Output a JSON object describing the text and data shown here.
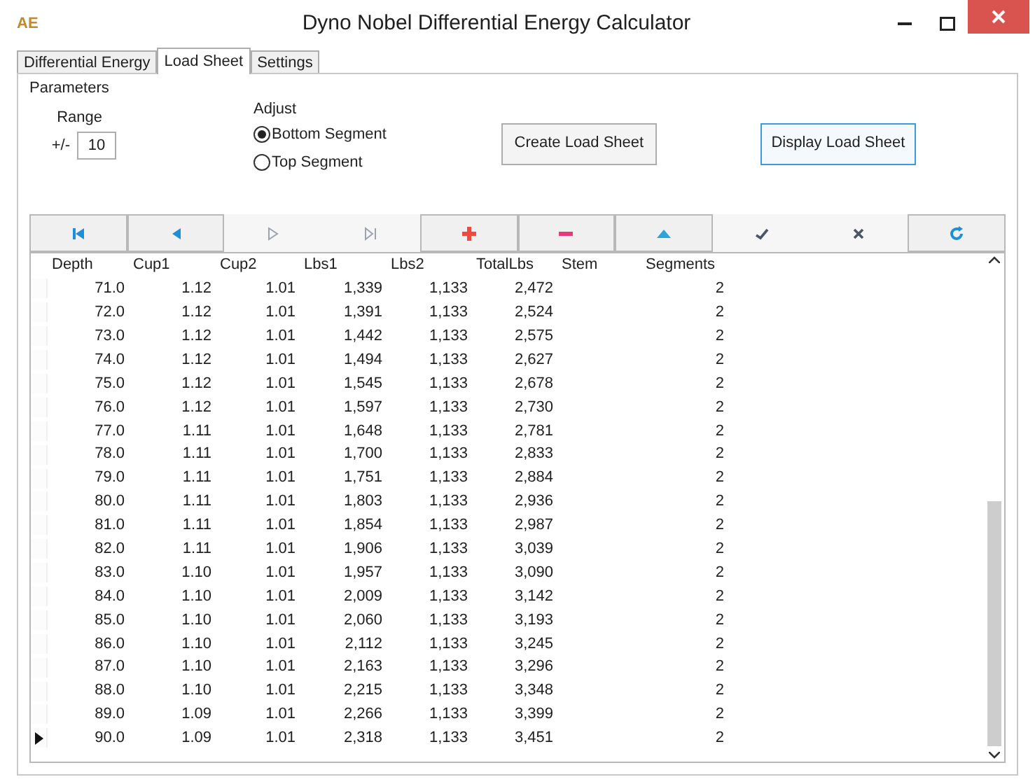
{
  "window": {
    "logo": "AE",
    "title": "Dyno Nobel Differential Energy Calculator"
  },
  "tabs": [
    {
      "label": "Differential Energy",
      "selected": false
    },
    {
      "label": "Load Sheet",
      "selected": true
    },
    {
      "label": "Settings",
      "selected": false
    }
  ],
  "parameters": {
    "title": "Parameters",
    "range_label": "Range",
    "range_prefix": "+/-",
    "range_value": "10",
    "adjust_label": "Adjust",
    "adjust_options": [
      {
        "label": "Bottom Segment",
        "selected": true
      },
      {
        "label": "Top Segment",
        "selected": false
      }
    ],
    "buttons": [
      {
        "label": "Create Load Sheet",
        "focused": false
      },
      {
        "label": "Display Load Sheet",
        "focused": true
      }
    ]
  },
  "toolbar": [
    {
      "kind": "first",
      "disabled": false
    },
    {
      "kind": "prev",
      "disabled": false
    },
    {
      "kind": "next",
      "disabled": true
    },
    {
      "kind": "last",
      "disabled": true
    },
    {
      "kind": "add",
      "disabled": false
    },
    {
      "kind": "delete",
      "disabled": false
    },
    {
      "kind": "edit",
      "disabled": false
    },
    {
      "kind": "post",
      "disabled": true
    },
    {
      "kind": "cancel",
      "disabled": true
    },
    {
      "kind": "refresh",
      "disabled": false
    }
  ],
  "table": {
    "columns": [
      "Depth",
      "Cup1",
      "Cup2",
      "Lbs1",
      "Lbs2",
      "TotalLbs",
      "Stem",
      "Segments"
    ],
    "rows": [
      {
        "cells": [
          "71.0",
          "1.12",
          "1.01",
          "1,339",
          "1,133",
          "2,472",
          "",
          "2"
        ],
        "selected": false
      },
      {
        "cells": [
          "72.0",
          "1.12",
          "1.01",
          "1,391",
          "1,133",
          "2,524",
          "",
          "2"
        ],
        "selected": false
      },
      {
        "cells": [
          "73.0",
          "1.12",
          "1.01",
          "1,442",
          "1,133",
          "2,575",
          "",
          "2"
        ],
        "selected": false
      },
      {
        "cells": [
          "74.0",
          "1.12",
          "1.01",
          "1,494",
          "1,133",
          "2,627",
          "",
          "2"
        ],
        "selected": false
      },
      {
        "cells": [
          "75.0",
          "1.12",
          "1.01",
          "1,545",
          "1,133",
          "2,678",
          "",
          "2"
        ],
        "selected": false
      },
      {
        "cells": [
          "76.0",
          "1.12",
          "1.01",
          "1,597",
          "1,133",
          "2,730",
          "",
          "2"
        ],
        "selected": false
      },
      {
        "cells": [
          "77.0",
          "1.11",
          "1.01",
          "1,648",
          "1,133",
          "2,781",
          "",
          "2"
        ],
        "selected": false
      },
      {
        "cells": [
          "78.0",
          "1.11",
          "1.01",
          "1,700",
          "1,133",
          "2,833",
          "",
          "2"
        ],
        "selected": false
      },
      {
        "cells": [
          "79.0",
          "1.11",
          "1.01",
          "1,751",
          "1,133",
          "2,884",
          "",
          "2"
        ],
        "selected": false
      },
      {
        "cells": [
          "80.0",
          "1.11",
          "1.01",
          "1,803",
          "1,133",
          "2,936",
          "",
          "2"
        ],
        "selected": false
      },
      {
        "cells": [
          "81.0",
          "1.11",
          "1.01",
          "1,854",
          "1,133",
          "2,987",
          "",
          "2"
        ],
        "selected": false
      },
      {
        "cells": [
          "82.0",
          "1.11",
          "1.01",
          "1,906",
          "1,133",
          "3,039",
          "",
          "2"
        ],
        "selected": false
      },
      {
        "cells": [
          "83.0",
          "1.10",
          "1.01",
          "1,957",
          "1,133",
          "3,090",
          "",
          "2"
        ],
        "selected": false
      },
      {
        "cells": [
          "84.0",
          "1.10",
          "1.01",
          "2,009",
          "1,133",
          "3,142",
          "",
          "2"
        ],
        "selected": false
      },
      {
        "cells": [
          "85.0",
          "1.10",
          "1.01",
          "2,060",
          "1,133",
          "3,193",
          "",
          "2"
        ],
        "selected": false
      },
      {
        "cells": [
          "86.0",
          "1.10",
          "1.01",
          "2,112",
          "1,133",
          "3,245",
          "",
          "2"
        ],
        "selected": false
      },
      {
        "cells": [
          "87.0",
          "1.10",
          "1.01",
          "2,163",
          "1,133",
          "3,296",
          "",
          "2"
        ],
        "selected": false
      },
      {
        "cells": [
          "88.0",
          "1.10",
          "1.01",
          "2,215",
          "1,133",
          "3,348",
          "",
          "2"
        ],
        "selected": false
      },
      {
        "cells": [
          "89.0",
          "1.09",
          "1.01",
          "2,266",
          "1,133",
          "3,399",
          "",
          "2"
        ],
        "selected": false
      },
      {
        "cells": [
          "90.0",
          "1.09",
          "1.01",
          "2,318",
          "1,133",
          "3,451",
          "",
          "2"
        ],
        "selected": true
      }
    ]
  }
}
